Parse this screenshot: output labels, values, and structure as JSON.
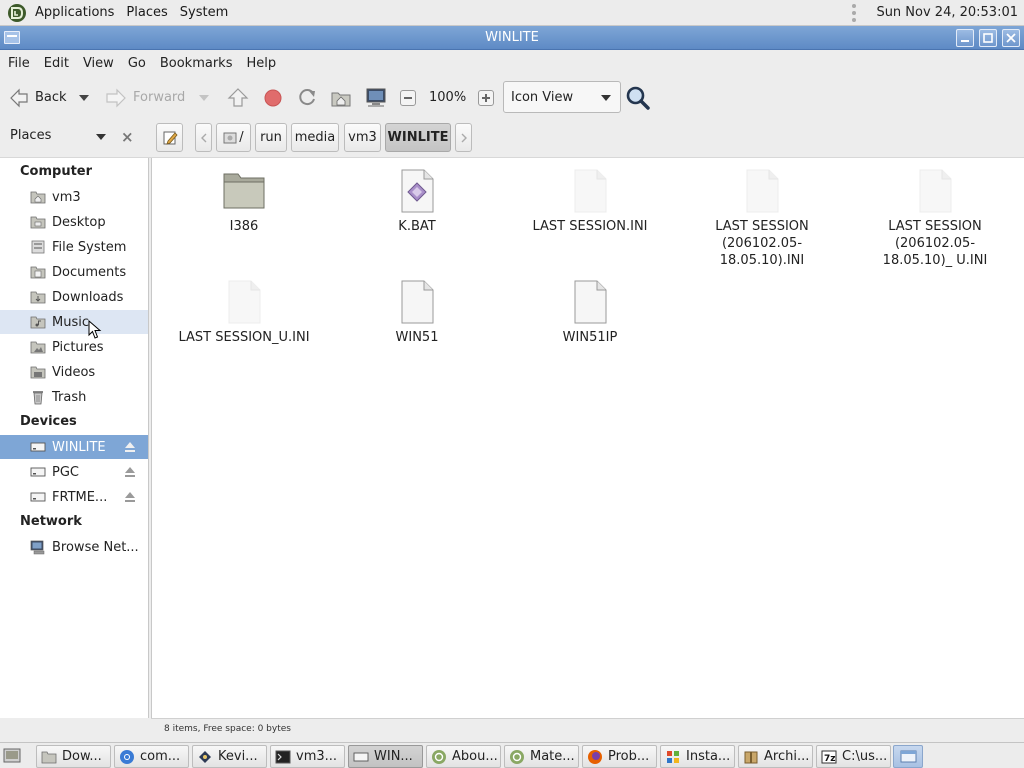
{
  "top_panel": {
    "menus": [
      "Applications",
      "Places",
      "System"
    ],
    "clock": "Sun Nov 24, 20:53:01"
  },
  "window": {
    "title": "WINLITE",
    "buttons": [
      "minimize",
      "maximize",
      "close"
    ]
  },
  "menubar": [
    "File",
    "Edit",
    "View",
    "Go",
    "Bookmarks",
    "Help"
  ],
  "toolbar": {
    "back_label": "Back",
    "forward_label": "Forward",
    "zoom_level": "100%",
    "view_mode": "Icon View"
  },
  "location": {
    "places_label": "Places",
    "root_label": "/",
    "breadcrumbs": [
      "run",
      "media",
      "vm3",
      "WINLITE"
    ]
  },
  "sidebar": {
    "computer_heading": "Computer",
    "computer_items": [
      "vm3",
      "Desktop",
      "File System",
      "Documents",
      "Downloads",
      "Music",
      "Pictures",
      "Videos",
      "Trash"
    ],
    "devices_heading": "Devices",
    "device_items": [
      "WINLITE",
      "PGC",
      "FRTME..."
    ],
    "network_heading": "Network",
    "network_items": [
      "Browse Net..."
    ]
  },
  "files": [
    {
      "name": "I386",
      "type": "folder"
    },
    {
      "name": "K.BAT",
      "type": "script"
    },
    {
      "name": "LAST SESSION.INI",
      "type": "blank"
    },
    {
      "name": "LAST SESSION (206102.05-18.05.10).INI",
      "type": "blank"
    },
    {
      "name": "LAST SESSION (206102.05-18.05.10)_ U.INI",
      "type": "blank"
    },
    {
      "name": "LAST SESSION_U.INI",
      "type": "blank"
    },
    {
      "name": "WIN51",
      "type": "doc"
    },
    {
      "name": "WIN51IP",
      "type": "doc"
    }
  ],
  "status": "8 items, Free space: 0 bytes",
  "taskbar": [
    "Dow...",
    "com...",
    "Kevi...",
    "vm3...",
    "WIN...",
    "Abou...",
    "Mate...",
    "Prob...",
    "Insta...",
    "Archi...",
    "C:\\us..."
  ],
  "colors": {
    "titlebar": "#6b94cb",
    "selection": "#7ea6d6",
    "hover": "#dde6f3"
  }
}
